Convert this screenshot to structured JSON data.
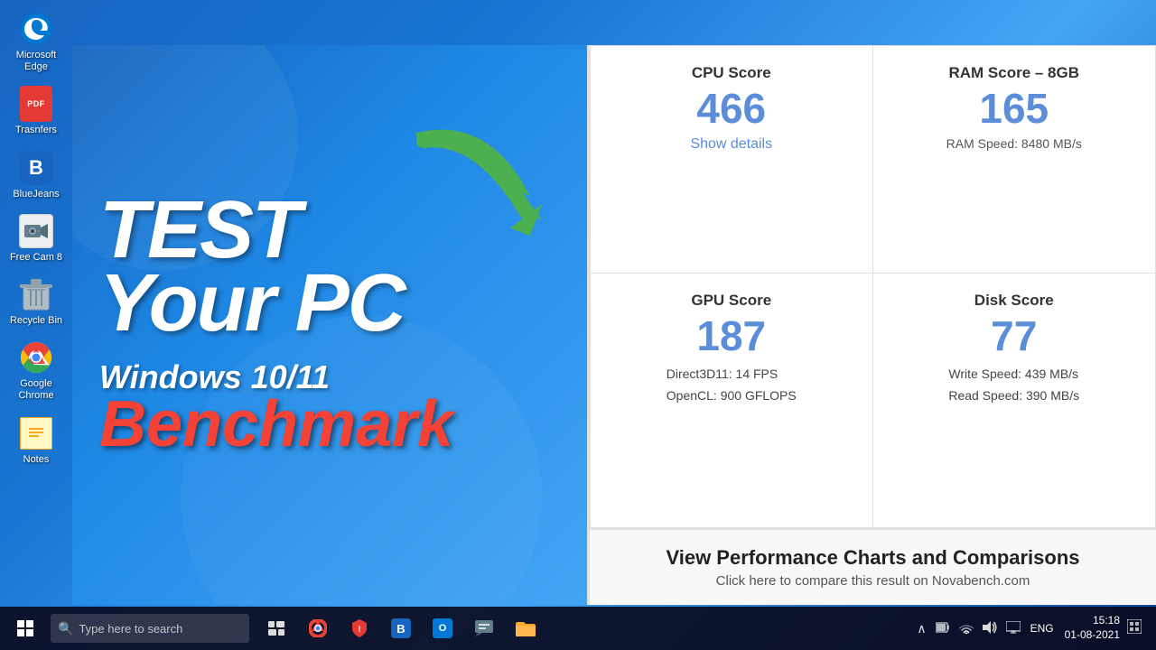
{
  "desktop": {
    "icons": [
      {
        "id": "edge",
        "label": "Microsoft Edge",
        "icon": "🌐",
        "type": "edge"
      },
      {
        "id": "transfers",
        "label": "Trasnfers",
        "icon": "📄",
        "type": "pdf"
      },
      {
        "id": "bluejeans",
        "label": "BlueJeans",
        "icon": "B",
        "type": "bluejeans"
      },
      {
        "id": "freecam",
        "label": "Free Cam 8",
        "icon": "🎥",
        "type": "freecam"
      },
      {
        "id": "recycle",
        "label": "Recycle Bin",
        "icon": "🗑️",
        "type": "recycle"
      },
      {
        "id": "chrome",
        "label": "Google Chrome",
        "icon": "🔵",
        "type": "chrome"
      },
      {
        "id": "notes",
        "label": "Notes",
        "icon": "📝",
        "type": "notes"
      }
    ]
  },
  "banner": {
    "left": {
      "line1": "TEST",
      "line2": "Your PC",
      "line3": "Windows 10/11",
      "line4": "Benchmark"
    }
  },
  "results": {
    "cpu": {
      "label": "CPU Score",
      "score": "466",
      "link_text": "Show details"
    },
    "ram": {
      "label": "RAM Score – 8GB",
      "score": "165",
      "detail": "RAM Speed: 8480 MB/s"
    },
    "gpu": {
      "label": "GPU Score",
      "score": "187",
      "detail_line1": "Direct3D11: 14 FPS",
      "detail_line2": "OpenCL: 900 GFLOPS"
    },
    "disk": {
      "label": "Disk Score",
      "score": "77",
      "detail_line1": "Write Speed: 439 MB/s",
      "detail_line2": "Read Speed: 390 MB/s"
    },
    "cta": {
      "title": "View Performance Charts and Comparisons",
      "subtitle": "Click here to compare this result on Novabench.com"
    }
  },
  "taskbar": {
    "search_placeholder": "Type here to search",
    "clock": {
      "time": "15:18",
      "date": "01-08-2021"
    },
    "language": "ENG",
    "icons": [
      {
        "id": "task-view",
        "unicode": "⊞",
        "active": false
      },
      {
        "id": "chrome-tb",
        "unicode": "🌐",
        "active": false
      },
      {
        "id": "shield-tb",
        "unicode": "🛡",
        "active": false
      },
      {
        "id": "bluejeans-tb",
        "unicode": "B",
        "active": false
      },
      {
        "id": "outlook-tb",
        "unicode": "✉",
        "active": false
      },
      {
        "id": "mail-tb",
        "unicode": "💬",
        "active": false
      },
      {
        "id": "folder-tb",
        "unicode": "📁",
        "active": false
      }
    ],
    "sys_icons": [
      "∧",
      "🔋",
      "📶",
      "🔊",
      "▭",
      "⌨"
    ]
  }
}
